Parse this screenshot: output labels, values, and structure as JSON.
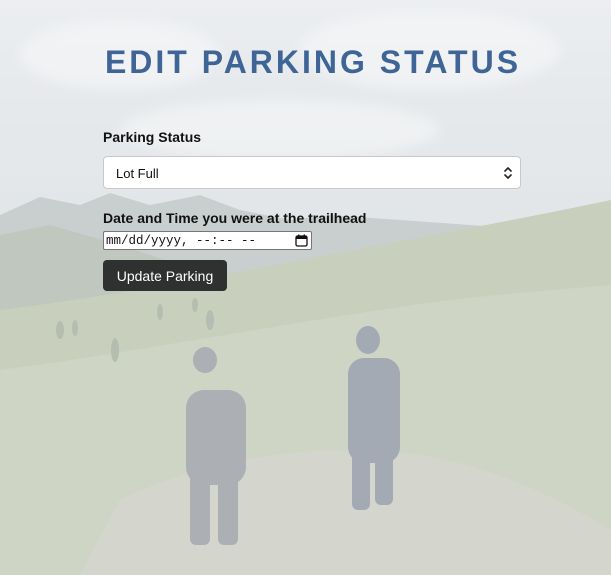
{
  "page": {
    "title": "EDIT PARKING STATUS"
  },
  "form": {
    "status_label": "Parking Status",
    "status_selected": "Lot Full",
    "datetime_label": "Date and Time you were at the trailhead",
    "datetime_placeholder": "mm/dd/yyyy, --:-- --",
    "submit_label": "Update Parking"
  },
  "icons": {
    "select_arrow": "chevron-updown-icon",
    "datetime_picker": "calendar-icon"
  },
  "colors": {
    "title": "#3f6597",
    "button_bg": "#2f3030",
    "button_text": "#ffffff"
  }
}
